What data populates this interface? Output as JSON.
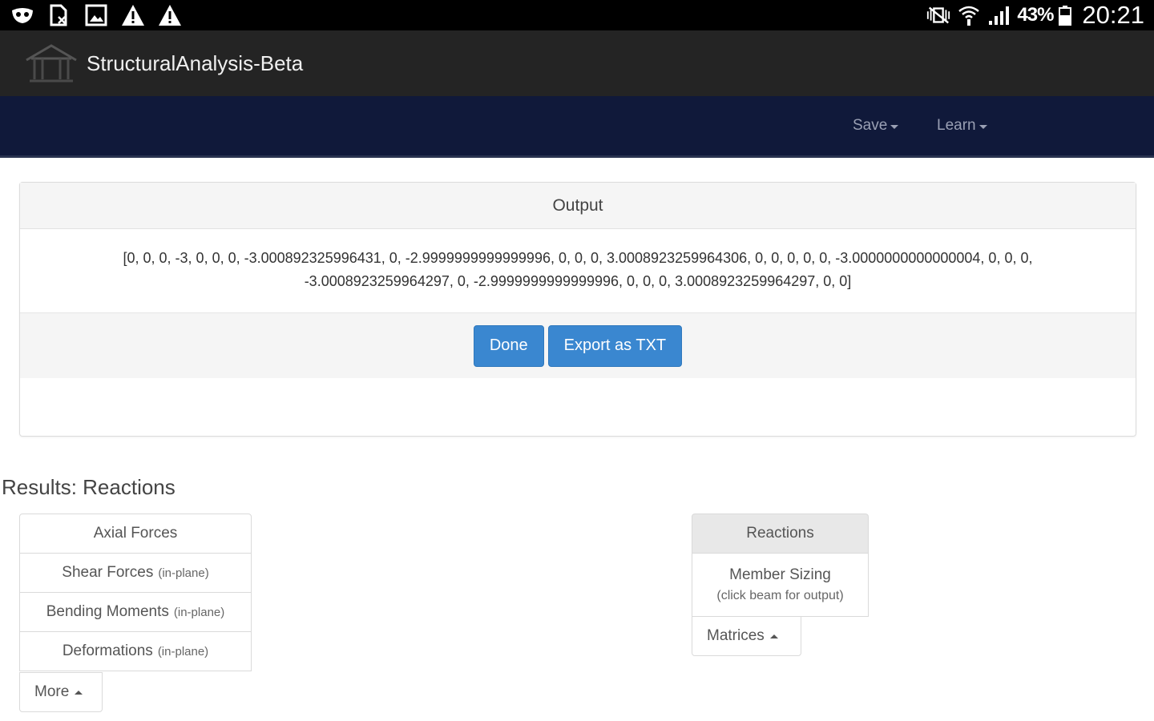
{
  "status_bar": {
    "battery_percent": "43%",
    "time": "20:21"
  },
  "app": {
    "title": "StructuralAnalysis-Beta"
  },
  "navbar": {
    "save_label": "Save",
    "learn_label": "Learn"
  },
  "output_panel": {
    "heading": "Output",
    "text": "[0, 0, 0, -3, 0, 0, 0, -3.000892325996431, 0, -2.9999999999999996, 0, 0, 0, 3.0008923259964306, 0, 0, 0, 0, 0, -3.0000000000000004, 0, 0, 0, -3.0008923259964297, 0, -2.9999999999999996, 0, 0, 0, 3.0008923259964297, 0, 0]",
    "done_label": "Done",
    "export_label": "Export as TXT"
  },
  "results": {
    "title": "Results: Reactions",
    "left_items": [
      {
        "label": "Axial Forces",
        "note": ""
      },
      {
        "label": "Shear Forces",
        "note": "(in-plane)"
      },
      {
        "label": "Bending Moments",
        "note": "(in-plane)"
      },
      {
        "label": "Deformations",
        "note": "(in-plane)"
      }
    ],
    "more_label": "More",
    "right_items": {
      "reactions_label": "Reactions",
      "member_sizing_label": "Member Sizing",
      "member_sizing_note": "(click beam for output)"
    },
    "matrices_label": "Matrices"
  }
}
